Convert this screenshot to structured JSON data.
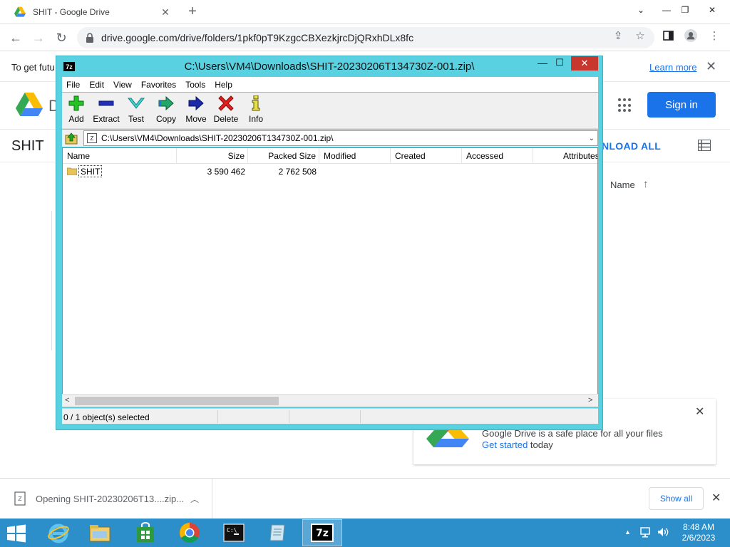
{
  "browser": {
    "tab_title": "SHIT - Google Drive",
    "url": "drive.google.com/drive/folders/1pkf0pT9KzgcCBXezkjrcDjQRxhDLx8fc"
  },
  "infobar": {
    "text": "To get futu",
    "learn_more": "Learn more"
  },
  "drive": {
    "logo_partial": "D",
    "sign_in": "Sign in",
    "folder_title": "SHIT",
    "download_all": "NLOAD ALL",
    "sort_label": "Name",
    "safe_card_text": "Google Drive is a safe place for all your files",
    "safe_card_link": "Get started",
    "safe_card_suffix": " today"
  },
  "sevenzip": {
    "title": "C:\\Users\\VM4\\Downloads\\SHIT-20230206T134730Z-001.zip\\",
    "icon_label": "7z",
    "menu": [
      "File",
      "Edit",
      "View",
      "Favorites",
      "Tools",
      "Help"
    ],
    "tools": [
      "Add",
      "Extract",
      "Test",
      "Copy",
      "Move",
      "Delete",
      "Info"
    ],
    "path": "C:\\Users\\VM4\\Downloads\\SHIT-20230206T134730Z-001.zip\\",
    "columns": [
      "Name",
      "Size",
      "Packed Size",
      "Modified",
      "Created",
      "Accessed",
      "Attributes"
    ],
    "rows": [
      {
        "name": "SHIT",
        "size": "3 590 462",
        "packed": "2 762 508"
      }
    ],
    "status": "0 / 1 object(s) selected"
  },
  "download_shelf": {
    "item_text": "Opening SHIT-20230206T13....zip...",
    "show_all": "Show all"
  },
  "taskbar": {
    "time": "8:48 AM",
    "date": "2/6/2023"
  },
  "colors": {
    "accent_blue": "#1a73e8",
    "sevenzip_frame": "#5ad1e1",
    "taskbar": "#2c8fc9",
    "close_red": "#c7372e"
  }
}
